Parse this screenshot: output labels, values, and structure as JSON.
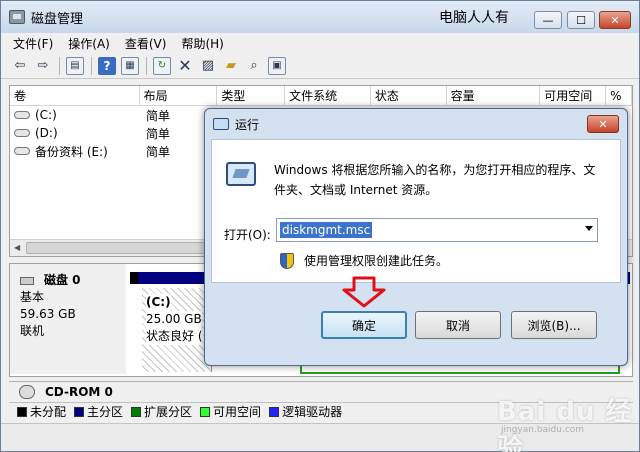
{
  "window": {
    "title": "磁盘管理",
    "brand_text": "电脑人人有",
    "minimize_glyph": "—",
    "maximize_glyph": "☐",
    "close_glyph": "✕"
  },
  "menu": [
    "文件(F)",
    "操作(A)",
    "查看(V)",
    "帮助(H)"
  ],
  "toolbar_icons": [
    "back-arrow-icon",
    "forward-arrow-icon",
    "console-tree-icon",
    "help-icon",
    "properties-icon",
    "refresh-icon",
    "delete-icon",
    "settings-icon",
    "open-folder-icon",
    "search-icon",
    "export-icon"
  ],
  "list": {
    "columns": [
      "卷",
      "布局",
      "类型",
      "文件系统",
      "状态",
      "容量",
      "可用空间",
      "%"
    ],
    "rows": [
      {
        "volume": "(C:)",
        "layout": "简单"
      },
      {
        "volume": "(D:)",
        "layout": "简单"
      },
      {
        "volume": "备份资料 (E:)",
        "layout": "简单"
      }
    ]
  },
  "disk0": {
    "name": "磁盘 0",
    "type": "基本",
    "size": "59.63 GB",
    "status": "联机",
    "partition": {
      "label": "(C:)",
      "size": "25.00 GB",
      "status": "状态良好 ("
    }
  },
  "cdrom": {
    "name": "CD-ROM 0"
  },
  "legend": [
    {
      "label": "未分配",
      "color": "#000000"
    },
    {
      "label": "主分区",
      "color": "#000080"
    },
    {
      "label": "扩展分区",
      "color": "#008000"
    },
    {
      "label": "可用空间",
      "color": "#33ff33"
    },
    {
      "label": "逻辑驱动器",
      "color": "#2222ff"
    }
  ],
  "run_dialog": {
    "title": "运行",
    "close_glyph": "✕",
    "description": "Windows 将根据您所输入的名称，为您打开相应的程序、文件夹、文档或 Internet 资源。",
    "open_label": "打开(O):",
    "open_value": "diskmgmt.msc",
    "admin_text": "使用管理权限创建此任务。",
    "ok_label": "确定",
    "cancel_label": "取消",
    "browse_label": "浏览(B)..."
  },
  "watermark": {
    "main": "Bai du 经验",
    "sub": "jingyan.baidu.com"
  },
  "accent_color": "#3c7fb1"
}
